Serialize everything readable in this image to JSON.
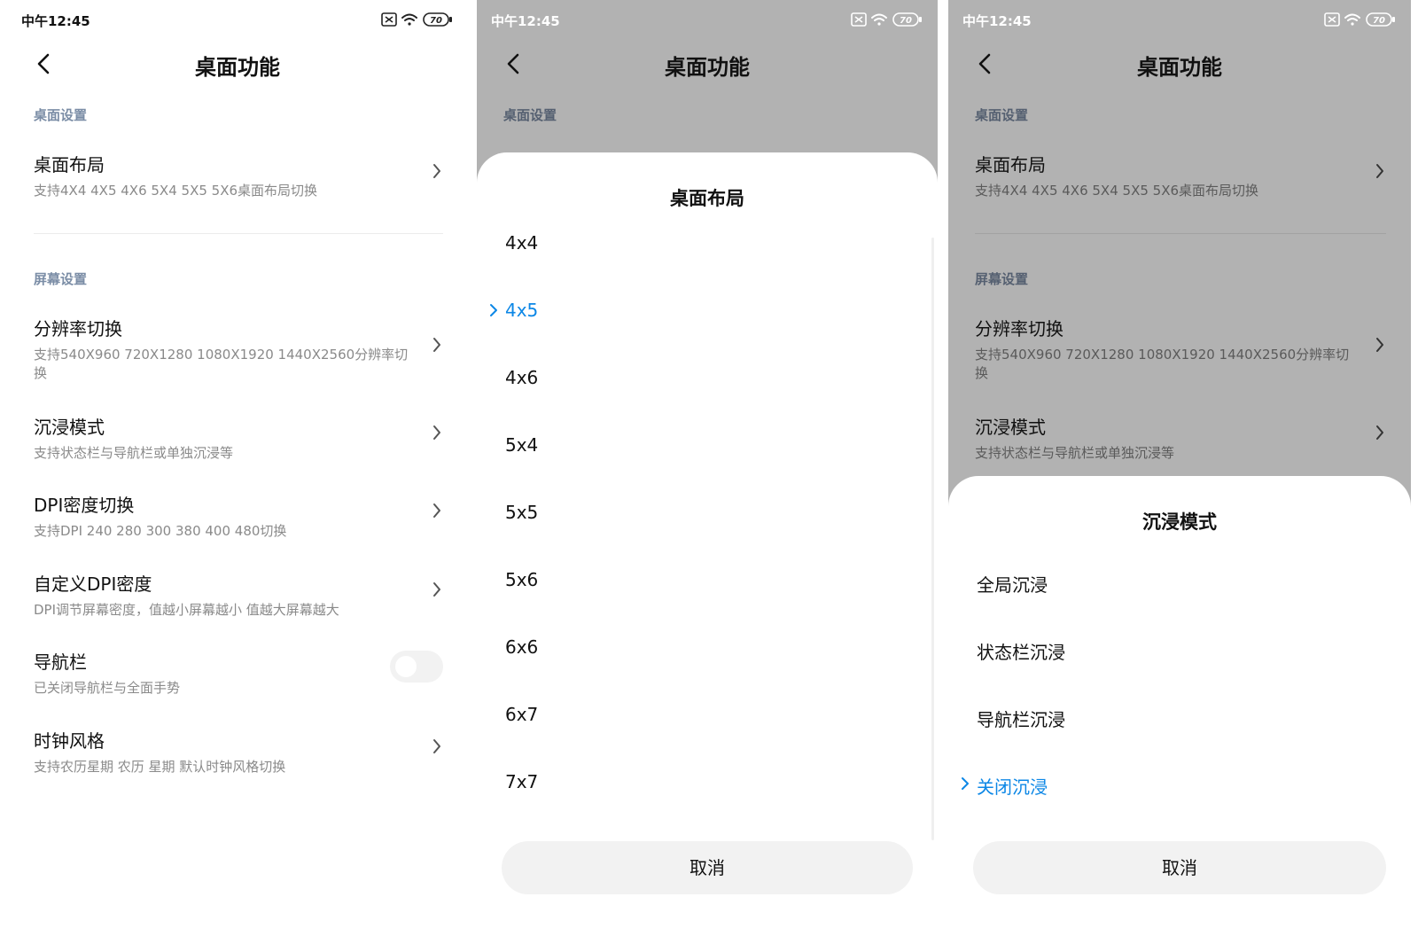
{
  "status": {
    "time": "中午12:45",
    "battery": "70"
  },
  "screen": {
    "title": "桌面功能",
    "sections": {
      "desktop": "桌面设置",
      "screen": "屏幕设置"
    },
    "items": [
      {
        "title": "桌面布局",
        "subtitle": "支持4X4 4X5 4X6 5X4 5X5 5X6桌面布局切换"
      },
      {
        "title": "分辨率切换",
        "subtitle": "支持540X960 720X1280 1080X1920 1440X2560分辨率切换"
      },
      {
        "title": "沉浸模式",
        "subtitle": "支持状态栏与导航栏或单独沉浸等"
      },
      {
        "title": "DPI密度切换",
        "subtitle": "支持DPI 240 280 300 380 400 480切换"
      },
      {
        "title": "自定义DPI密度",
        "subtitle": "DPI调节屏幕密度，值越小屏幕越小 值越大屏幕越大"
      },
      {
        "title": "导航栏",
        "subtitle": "已关闭导航栏与全面手势",
        "toggle_on": false
      },
      {
        "title": "时钟风格",
        "subtitle": "支持农历星期 农历 星期 默认时钟风格切换"
      }
    ]
  },
  "layout_sheet": {
    "title": "桌面布局",
    "options": [
      "4x4",
      "4x5",
      "4x6",
      "5x4",
      "5x5",
      "5x6",
      "6x6",
      "6x7",
      "7x7"
    ],
    "selected_index": 1,
    "cancel": "取消"
  },
  "immersive_sheet": {
    "title": "沉浸模式",
    "options": [
      "全局沉浸",
      "状态栏沉浸",
      "导航栏沉浸",
      "关闭沉浸"
    ],
    "selected_index": 3,
    "cancel": "取消"
  },
  "colors": {
    "accent": "#0c87e6",
    "dim_overlay": "#b2b2b2",
    "section_label": "#7b8da6"
  }
}
